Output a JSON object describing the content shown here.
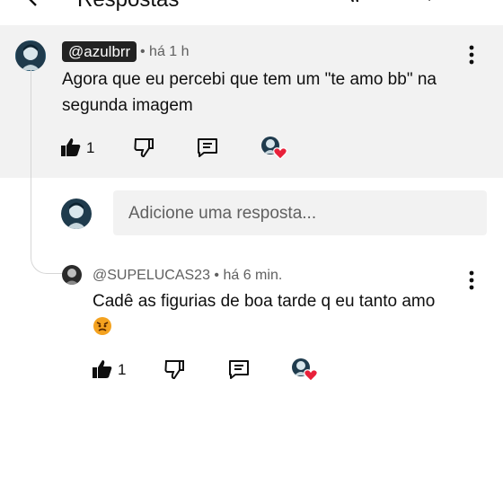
{
  "header": {
    "title": "Respostas"
  },
  "parent_comment": {
    "author": "@azulbrr",
    "meta": "• há 1 h",
    "text": "Agora que eu percebi que tem um \"te amo bb\" na segunda imagem",
    "likes": "1"
  },
  "reply_input": {
    "placeholder": "Adicione uma resposta..."
  },
  "reply_comment": {
    "author": "@SUPELUCAS23",
    "meta": "• há 6 min.",
    "text": "Cadê as figurias de boa tarde q eu tanto amo",
    "likes": "1"
  },
  "colors": {
    "highlight_bg": "#f2f2f2",
    "heart": "#e8213a",
    "chip_bg": "#222222"
  }
}
